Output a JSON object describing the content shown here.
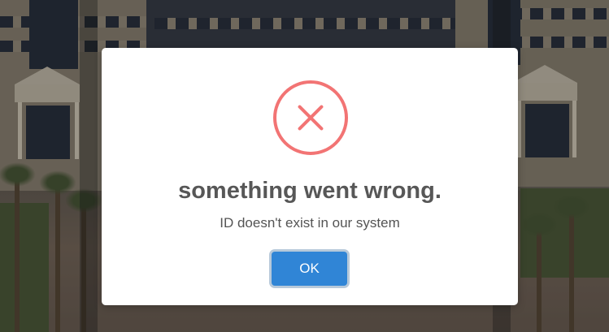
{
  "dialog": {
    "icon": "error-x-icon",
    "title": "something went wrong.",
    "message": "ID doesn't exist in our system",
    "ok_label": "OK"
  },
  "colors": {
    "icon": "#f27474",
    "confirm_button": "#3085d6",
    "title_text": "#575757"
  }
}
